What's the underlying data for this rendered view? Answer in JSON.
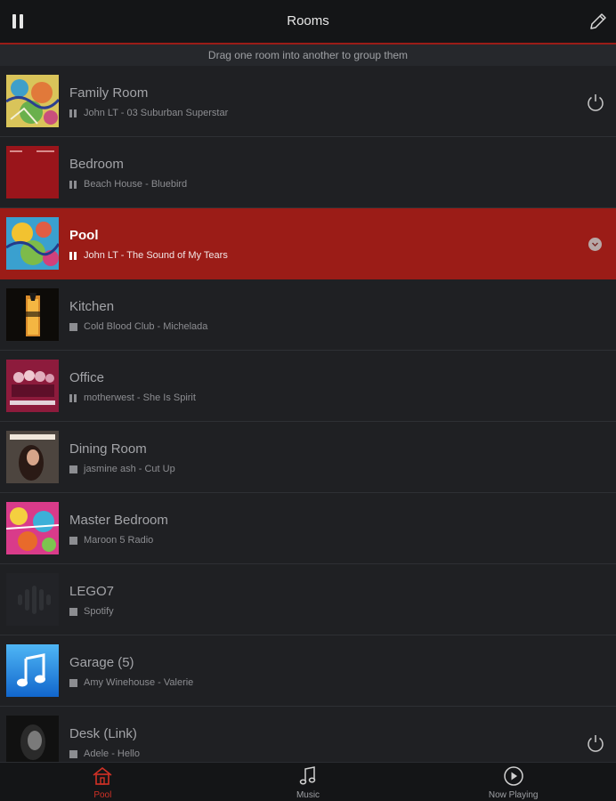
{
  "header": {
    "title": "Rooms",
    "left_icon": "pause-icon",
    "right_icon": "pencil-icon"
  },
  "hint": "Drag one room into another to group them",
  "rooms": [
    {
      "name": "Family Room",
      "track": "John LT - 03 Suburban Superstar",
      "state": "playing",
      "power": true,
      "active": false
    },
    {
      "name": "Bedroom",
      "track": "Beach House - Bluebird",
      "state": "playing",
      "power": false,
      "active": false
    },
    {
      "name": "Pool",
      "track": "John LT - The Sound of My Tears",
      "state": "playing",
      "power": false,
      "active": true
    },
    {
      "name": "Kitchen",
      "track": "Cold Blood Club - Michelada",
      "state": "stopped",
      "power": false,
      "active": false
    },
    {
      "name": "Office",
      "track": "motherwest - She Is Spirit",
      "state": "playing",
      "power": false,
      "active": false
    },
    {
      "name": "Dining Room",
      "track": "jasmine ash - Cut Up",
      "state": "stopped",
      "power": false,
      "active": false
    },
    {
      "name": "Master Bedroom",
      "track": "Maroon 5 Radio",
      "state": "stopped",
      "power": false,
      "active": false
    },
    {
      "name": "LEGO7",
      "track": "Spotify",
      "state": "stopped",
      "power": false,
      "active": false
    },
    {
      "name": "Garage (5)",
      "track": "Amy Winehouse - Valerie",
      "state": "stopped",
      "power": false,
      "active": false
    },
    {
      "name": "Desk (Link)",
      "track": "Adele - Hello",
      "state": "stopped",
      "power": true,
      "active": false
    }
  ],
  "tabs": [
    {
      "label": "Pool",
      "icon": "house-icon",
      "active": true
    },
    {
      "label": "Music",
      "icon": "music-note-icon",
      "active": false
    },
    {
      "label": "Now Playing",
      "icon": "play-circle-icon",
      "active": false
    }
  ],
  "colors": {
    "accent": "#9b1c17",
    "active_tab": "#d23126",
    "background": "#1e1f22"
  }
}
